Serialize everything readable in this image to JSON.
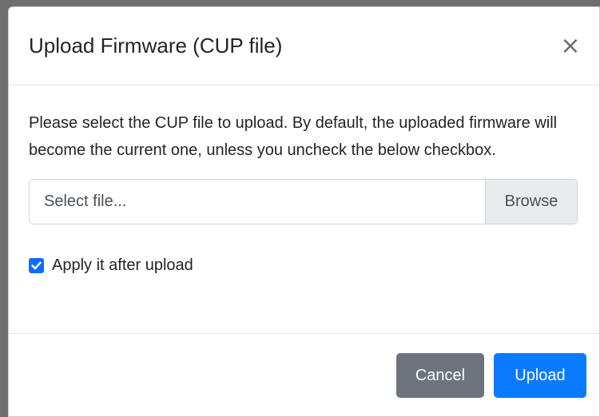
{
  "dialog": {
    "title": "Upload Firmware (CUP file)",
    "close_label": "×"
  },
  "body": {
    "description": "Please select the CUP file to upload. By default, the uploaded firmware will become the current one, unless you uncheck the below checkbox.",
    "file_input": {
      "placeholder": "Select file...",
      "browse_label": "Browse"
    },
    "apply_checkbox": {
      "label": "Apply it after upload",
      "checked": true
    }
  },
  "footer": {
    "cancel_label": "Cancel",
    "upload_label": "Upload"
  },
  "colors": {
    "primary": "#0a7bff",
    "secondary": "#6c757d"
  }
}
